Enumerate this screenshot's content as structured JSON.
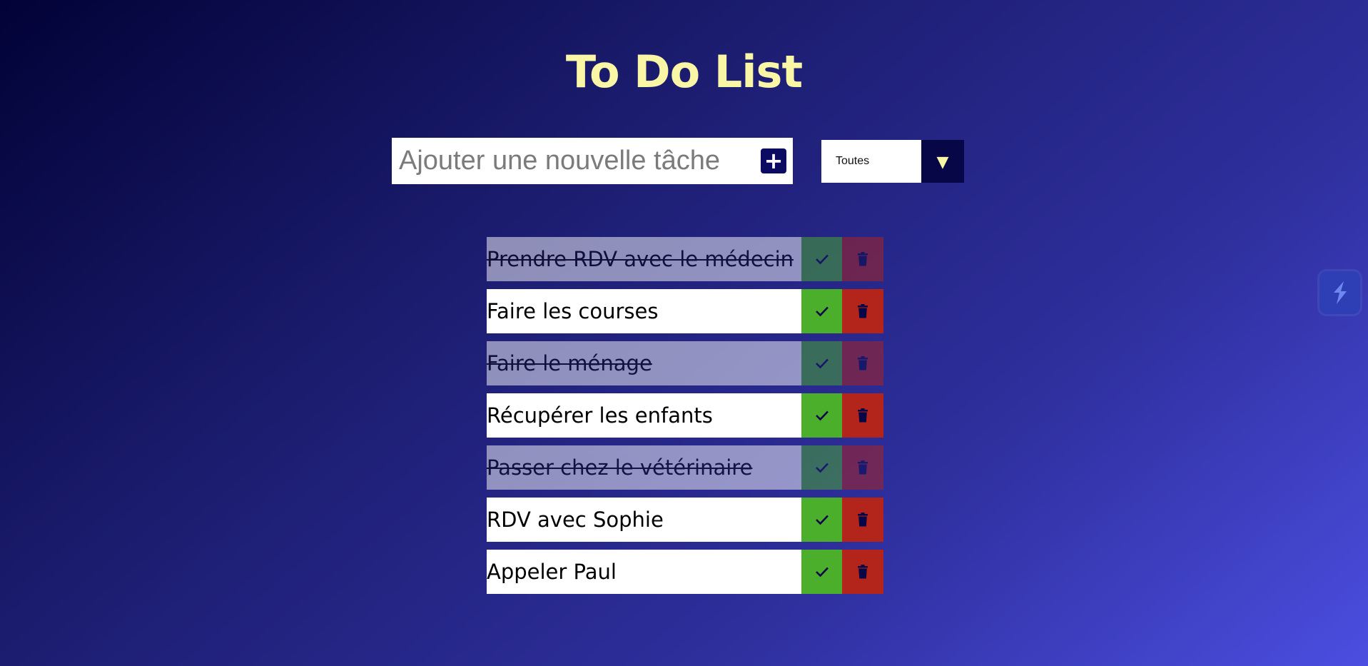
{
  "app": {
    "title": "To Do List"
  },
  "form": {
    "placeholder": "Ajouter une nouvelle tâche",
    "add_label": "+"
  },
  "filter": {
    "selected": "Toutes",
    "arrow": "▼"
  },
  "colors": {
    "title": "#f9f6a6",
    "complete_button": "#4caf2c",
    "trash_button": "#b3241a",
    "icon": "#070747"
  },
  "todos": [
    {
      "text": "Prendre RDV avec le médecin",
      "completed": true
    },
    {
      "text": "Faire les courses",
      "completed": false
    },
    {
      "text": "Faire le ménage",
      "completed": true
    },
    {
      "text": "Récupérer les enfants",
      "completed": false
    },
    {
      "text": "Passer chez le vétérinaire",
      "completed": true
    },
    {
      "text": "RDV avec Sophie",
      "completed": false
    },
    {
      "text": "Appeler Paul",
      "completed": false
    }
  ],
  "icons": {
    "complete": "check-icon",
    "delete": "trash-icon",
    "widget": "lightning-icon"
  }
}
